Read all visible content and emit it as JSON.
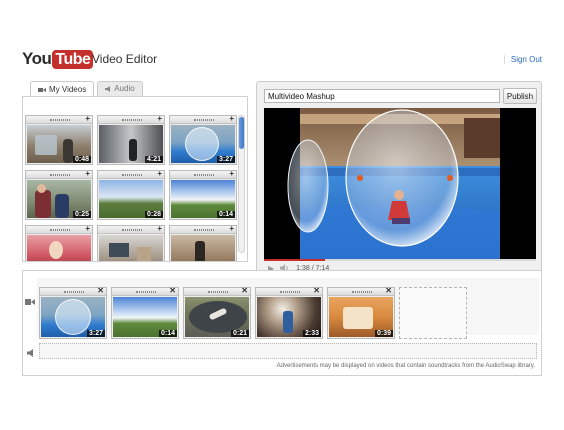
{
  "header": {
    "logo_you": "You",
    "logo_tube": "Tube",
    "title": "Video Editor",
    "sign_out": "Sign Out"
  },
  "library": {
    "tabs": [
      {
        "label": "My Videos",
        "icon": "video-camera-icon",
        "active": true
      },
      {
        "label": "Audio",
        "icon": "speaker-icon",
        "active": false
      }
    ],
    "videos": [
      {
        "duration": "0:48"
      },
      {
        "duration": "4:21"
      },
      {
        "duration": "3:27"
      },
      {
        "duration": "0:25"
      },
      {
        "duration": "0:28"
      },
      {
        "duration": "0:14"
      },
      {
        "duration": ""
      },
      {
        "duration": ""
      },
      {
        "duration": ""
      }
    ]
  },
  "player": {
    "title_value": "Multivideo Mashup",
    "publish_label": "Publish",
    "time": "1:38 / 7:14",
    "progress": 0.226
  },
  "timeline": {
    "clips": [
      {
        "duration": "3:27"
      },
      {
        "duration": "0:14"
      },
      {
        "duration": "0:21"
      },
      {
        "duration": "2:33"
      },
      {
        "duration": "0:39"
      }
    ],
    "notice": "Advertisements may be displayed on videos that contain soundtracks from the AudioSwap library."
  },
  "colors": {
    "brand_red": "#c4302b",
    "link_blue": "#2a6bbf",
    "scroll_blue": "#3f78c7"
  }
}
